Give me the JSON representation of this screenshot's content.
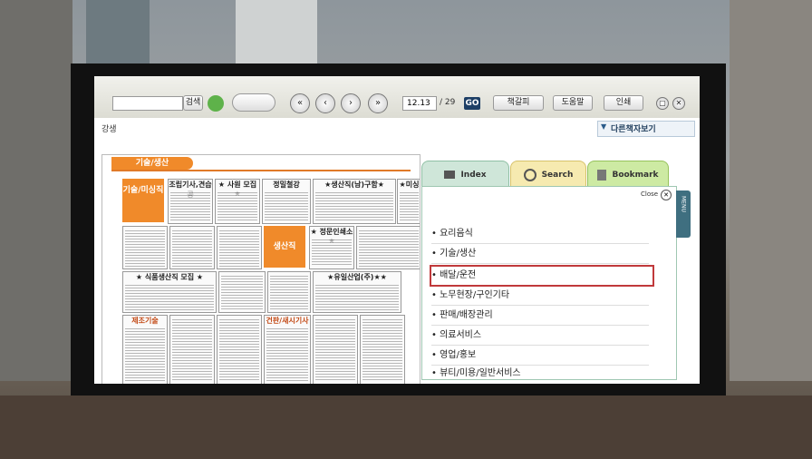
{
  "toolbar": {
    "search_label": "검색",
    "page_current": "12.13",
    "page_total": "/ 29",
    "go_label": "GO",
    "zoom_label": "책갈피",
    "help_label": "도움말",
    "print_label": "인쇄",
    "first_icon": "double-left-icon",
    "prev_icon": "left-icon",
    "next_icon": "right-icon",
    "last_icon": "double-right-icon"
  },
  "subbar": {
    "left_text": "강생",
    "other_books": "다른책자보기"
  },
  "newspaper": {
    "header": "기술/생산",
    "left_tag": "기술/미싱직",
    "ads": [
      "조립기사,견습공",
      "★ 사원 모집 ★",
      "정밀철강",
      "★생산직(남)구함★",
      "★미싱",
      "★ 식품생산직 모집 ★",
      "생산직",
      "★ 정문인쇄소 ★",
      "★유일산업(주)★★",
      "제조기술",
      "건판/새시기사"
    ]
  },
  "panel": {
    "tabs": [
      "Index",
      "Search",
      "Bookmark"
    ],
    "close_label": "Close",
    "side_tab": "MENU",
    "items": [
      "요리음식",
      "기술/생산",
      "배달/운전",
      "노무현장/구인기타",
      "판매/배장관리",
      "의료서비스",
      "영업/홍보",
      "뷰티/미용/일반서비스"
    ],
    "selected_index": 2
  },
  "colors": {
    "selected_border": "#c0393b",
    "index_tab": "#cfe6d9",
    "search_tab": "#f6eab0",
    "bookmark_tab": "#cdeaa3"
  }
}
